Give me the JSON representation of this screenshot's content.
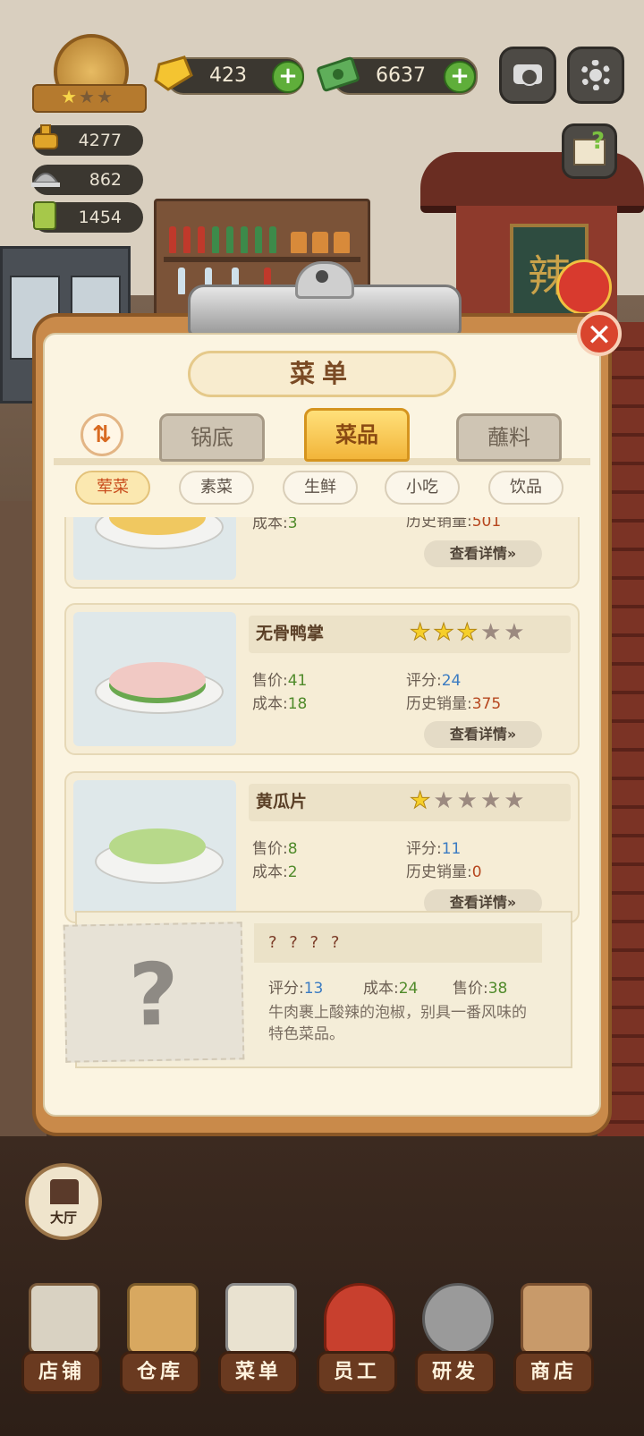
{
  "hud": {
    "gems": "423",
    "cash": "6637",
    "stat_1": "4277",
    "stat_2": "862",
    "stat_3": "1454",
    "badge_stars_filled": 1,
    "badge_stars_total": 3
  },
  "menu": {
    "title": "菜单",
    "close": "✕",
    "sort_icon": "⇅",
    "tabs": [
      {
        "label": "锅底",
        "active": false
      },
      {
        "label": "菜品",
        "active": true
      },
      {
        "label": "蘸料",
        "active": false
      }
    ],
    "categories": [
      {
        "label": "荤菜",
        "active": true
      },
      {
        "label": "素菜",
        "active": false
      },
      {
        "label": "生鲜",
        "active": false
      },
      {
        "label": "小吃",
        "active": false
      },
      {
        "label": "饮品",
        "active": false
      }
    ],
    "items": [
      {
        "name": "",
        "cost_label": "成本:",
        "cost": "3",
        "sales_label": "历史销量:",
        "sales": "501",
        "detail": "查看详情»"
      },
      {
        "name": "无骨鸭掌",
        "stars": 3,
        "price_label": "售价:",
        "price": "41",
        "score_label": "评分:",
        "score": "24",
        "cost_label": "成本:",
        "cost": "18",
        "sales_label": "历史销量:",
        "sales": "375",
        "detail": "查看详情»"
      },
      {
        "name": "黄瓜片",
        "stars": 1,
        "price_label": "售价:",
        "price": "8",
        "score_label": "评分:",
        "score": "11",
        "cost_label": "成本:",
        "cost": "2",
        "sales_label": "历史销量:",
        "sales": "0",
        "detail": "查看详情»"
      }
    ],
    "locked_item": {
      "name": "? ? ? ?",
      "qmark": "?",
      "score_label": "评分:",
      "score": "13",
      "cost_label": "成本:",
      "cost": "24",
      "price_label": "售价:",
      "price": "38",
      "description": "牛肉裹上酸辣的泡椒，别具一番风味的特色菜品。"
    }
  },
  "hall": {
    "label": "大厅"
  },
  "nav": [
    {
      "label": "店铺",
      "icon": "shop-icon"
    },
    {
      "label": "仓库",
      "icon": "warehouse-icon"
    },
    {
      "label": "菜单",
      "icon": "menu-icon"
    },
    {
      "label": "员工",
      "icon": "staff-icon"
    },
    {
      "label": "研发",
      "icon": "research-icon"
    },
    {
      "label": "商店",
      "icon": "store-icon"
    }
  ],
  "colors": {
    "accent_orange": "#d86a22",
    "tab_active": "#f2b53a",
    "value_green": "#4f8a2a",
    "value_blue": "#3a7bc2",
    "value_red": "#b6461e",
    "close_red": "#d9452e"
  }
}
